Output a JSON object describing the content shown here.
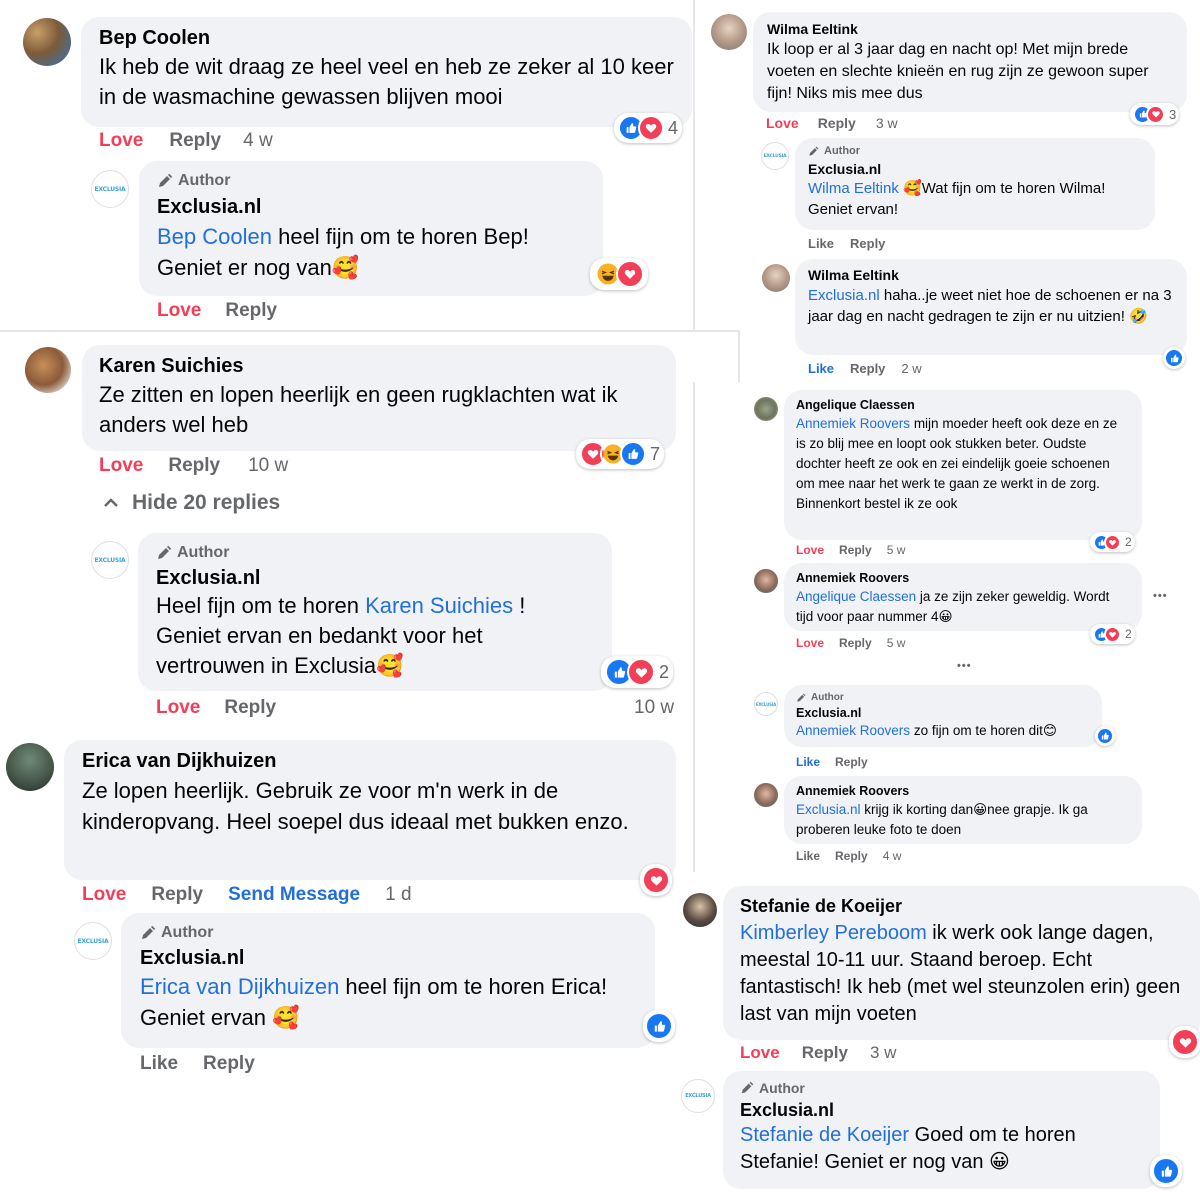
{
  "author_label": "Author",
  "icons": {
    "pencil": "pencil-icon",
    "like": "like-icon",
    "love": "love-icon",
    "haha": "haha-icon",
    "chevron_up": "chevron-up-icon",
    "more": "more-dots-icon"
  },
  "colors": {
    "love": "#f33e58",
    "link": "#216fdb",
    "like": "#1877f2",
    "bubble": "#f0f2f5",
    "muted": "#65676b"
  },
  "left": {
    "bep": {
      "name": "Bep Coolen",
      "text": "Ik heb de wit draag ze heel veel en heb ze zeker al 10 keer in de wasmachine gewassen blijven mooi",
      "love": "Love",
      "reply": "Reply",
      "time": "4 w",
      "reactions": "4"
    },
    "bep_reply": {
      "author": "Exclusia.nl",
      "mention": "Bep Coolen",
      "text": " heel fijn om te horen Bep! Geniet er nog van🥰",
      "love": "Love",
      "reply": "Reply"
    },
    "karen": {
      "name": "Karen Suichies",
      "text": "Ze zitten en lopen heerlijk en geen rugklachten wat ik anders wel heb",
      "love": "Love",
      "reply": "Reply",
      "time": "10 w",
      "reactions": "7",
      "hide_replies": "Hide 20 replies"
    },
    "karen_reply": {
      "author": "Exclusia.nl",
      "prefix": "Heel fijn om te horen ",
      "mention": "Karen Suichies",
      "text": " ! Geniet ervan en bedankt voor het vertrouwen in Exclusia🥰",
      "love": "Love",
      "reply": "Reply",
      "time": "10 w",
      "reactions": "2"
    },
    "erica": {
      "name": "Erica van Dijkhuizen",
      "text": "Ze lopen heerlijk. Gebruik ze voor m'n werk in de kinderopvang. Heel soepel dus ideaal met bukken enzo.",
      "love": "Love",
      "reply": "Reply",
      "send": "Send Message",
      "time": "1 d"
    },
    "erica_reply": {
      "author": "Exclusia.nl",
      "mention": "Erica van Dijkhuizen",
      "text": " heel fijn om te horen Erica! Geniet ervan 🥰",
      "like": "Like",
      "reply": "Reply"
    }
  },
  "right": {
    "wilma": {
      "name": "Wilma Eeltink",
      "text": "Ik loop er al 3 jaar dag en nacht op! Met mijn brede voeten en slechte knieën en rug zijn ze gewoon super fijn! Niks mis mee dus",
      "love": "Love",
      "reply": "Reply",
      "time": "3 w",
      "reactions": "3"
    },
    "wilma_reply": {
      "author": "Exclusia.nl",
      "mention": "Wilma Eeltink",
      "text": " 🥰Wat fijn om te horen Wilma! Geniet ervan!",
      "like": "Like",
      "reply": "Reply"
    },
    "wilma2": {
      "name": "Wilma Eeltink",
      "mention": "Exclusia.nl",
      "text": " haha..je weet niet hoe de schoenen er na 3 jaar dag en nacht gedragen te zijn er nu uitzien! 🤣",
      "like": "Like",
      "reply": "Reply",
      "time": "2 w"
    },
    "angelique": {
      "name": "Angelique Claessen",
      "mention": "Annemiek Roovers",
      "text": " mijn moeder heeft ook deze en ze is zo blij mee en loopt ook stukken beter. Oudste dochter heeft ze ook en zei eindelijk goeie schoenen om mee naar het werk te gaan ze werkt in de zorg.",
      "text2": "Binnenkort bestel ik ze ook",
      "love": "Love",
      "reply": "Reply",
      "time": "5 w",
      "reactions": "2"
    },
    "annemiek": {
      "name": "Annemiek Roovers",
      "mention": "Angelique Claessen",
      "text": " ja ze zijn zeker geweldig. Wordt tijd voor paar nummer 4😀",
      "love": "Love",
      "reply": "Reply",
      "time": "5 w",
      "reactions": "2",
      "more": "•••"
    },
    "middle_more": "•••",
    "annemiek_reply": {
      "author": "Exclusia.nl",
      "mention": "Annemiek Roovers",
      "text": " zo fijn om te horen dit😊",
      "like": "Like",
      "reply": "Reply"
    },
    "annemiek2": {
      "name": "Annemiek Roovers",
      "mention": "Exclusia.nl",
      "text": " krijg ik korting dan😀nee grapje. Ik ga proberen leuke foto te doen",
      "like": "Like",
      "reply": "Reply",
      "time": "4 w"
    },
    "stefanie": {
      "name": "Stefanie de Koeijer",
      "mention": "Kimberley Pereboom",
      "text": " ik werk ook lange dagen, meestal 10-11 uur. Staand beroep. Echt fantastisch! Ik heb (met wel steunzolen erin) geen last van mijn voeten",
      "love": "Love",
      "reply": "Reply",
      "time": "3 w"
    },
    "stefanie_reply": {
      "author": "Exclusia.nl",
      "mention": "Stefanie de Koeijer",
      "text": " Goed om te horen Stefanie! Geniet er nog van 😀"
    }
  }
}
